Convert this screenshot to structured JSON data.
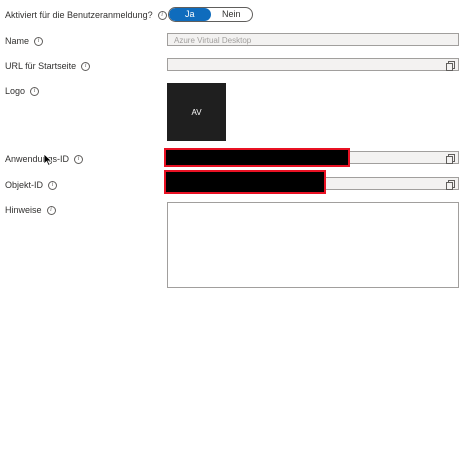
{
  "enabled_for_login": {
    "label": "Aktiviert für die Benutzeranmeldung?",
    "options": [
      "Ja",
      "Nein"
    ],
    "selected": "Ja"
  },
  "name": {
    "label": "Name",
    "value": "Azure Virtual Desktop"
  },
  "homepage_url": {
    "label": "URL für Startseite",
    "value": ""
  },
  "logo": {
    "label": "Logo",
    "initials": "AV"
  },
  "application_id": {
    "label": "Anwendungs-ID"
  },
  "object_id": {
    "label": "Objekt-ID"
  },
  "notes": {
    "label": "Hinweise",
    "value": ""
  },
  "icons": {
    "info": "info-icon",
    "copy": "copy-icon",
    "cursor": "mouse-pointer-icon"
  },
  "colors": {
    "toggle_selected": "#0f6cbd",
    "redaction_border": "#e81123",
    "logo_background": "#1f1f1f"
  }
}
